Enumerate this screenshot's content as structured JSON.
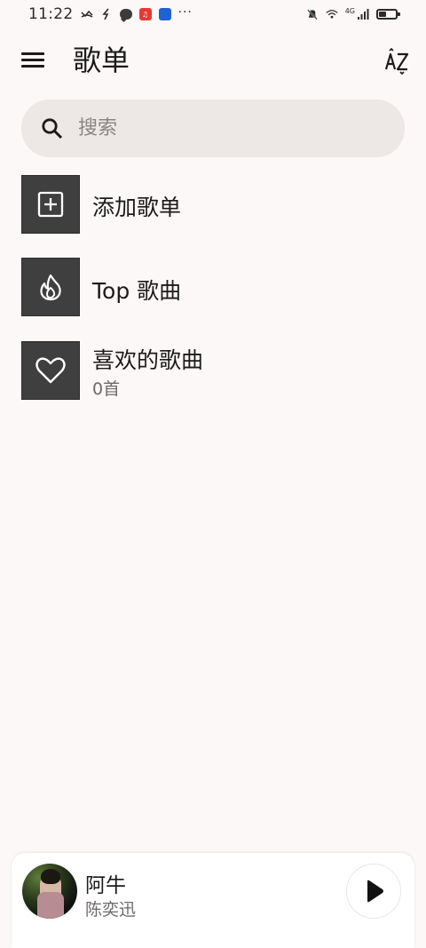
{
  "status_bar": {
    "time": "11:22",
    "network": "4G",
    "icons": [
      "missed-call-icon",
      "nfc-icon",
      "chat-icon",
      "red-app-badge-icon",
      "blue-app-badge-icon",
      "more-dots-icon",
      "silent-bell-icon",
      "wifi-icon",
      "signal-icon",
      "battery-icon"
    ],
    "battery_level": 0.45
  },
  "app_bar": {
    "title": "歌单",
    "menu_icon": "menu-icon",
    "sort_icon": "sort-az-icon"
  },
  "search": {
    "placeholder": "搜索",
    "value": "",
    "icon": "search-icon"
  },
  "playlists": [
    {
      "icon": "add-box-icon",
      "title": "添加歌单",
      "subtitle": ""
    },
    {
      "icon": "fire-icon",
      "title": "Top 歌曲",
      "subtitle": ""
    },
    {
      "icon": "heart-icon",
      "title": "喜欢的歌曲",
      "subtitle": "0首"
    }
  ],
  "now_playing": {
    "title": "阿牛",
    "artist": "陈奕迅",
    "play_icon": "play-icon"
  },
  "colors": {
    "background": "#fcf8f7",
    "search_background": "#ede7e6",
    "thumbnail": "#3f3f3f",
    "primary_text": "#1c1b1b",
    "secondary_text": "#6d6968"
  }
}
